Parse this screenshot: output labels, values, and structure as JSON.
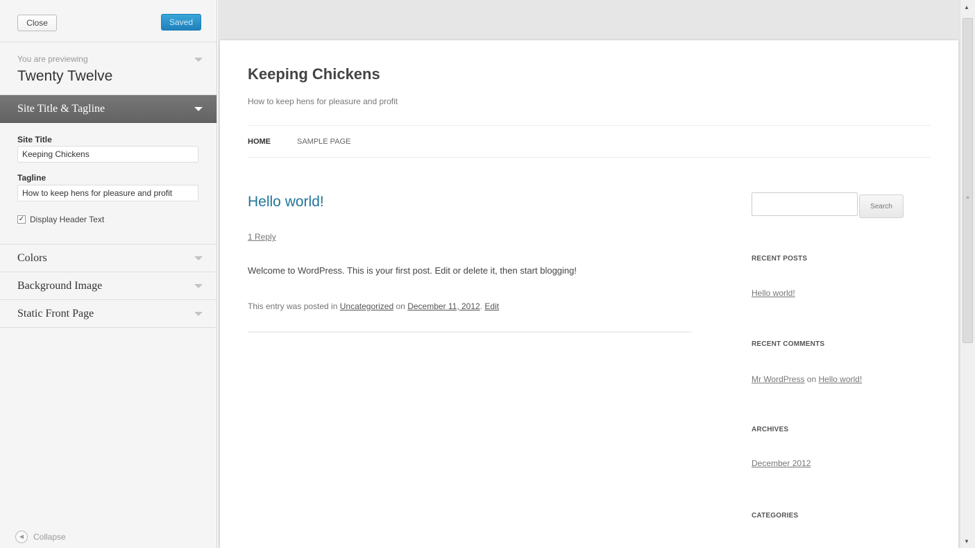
{
  "header": {
    "close_label": "Close",
    "saved_label": "Saved"
  },
  "preview_info": {
    "small_text": "You are previewing",
    "theme_name": "Twenty Twelve"
  },
  "sections": {
    "site_title": "Site Title & Tagline",
    "colors": "Colors",
    "background": "Background Image",
    "static_front": "Static Front Page"
  },
  "fields": {
    "site_title_label": "Site Title",
    "site_title_value": "Keeping Chickens",
    "tagline_label": "Tagline",
    "tagline_value": "How to keep hens for pleasure and profit",
    "display_header_label": "Display Header Text",
    "display_header_checked": true
  },
  "footer": {
    "collapse_label": "Collapse"
  },
  "site": {
    "title": "Keeping Chickens",
    "tagline": "How to keep hens for pleasure and profit",
    "nav": [
      "HOME",
      "SAMPLE PAGE"
    ]
  },
  "post": {
    "title": "Hello world!",
    "reply": "1 Reply",
    "body": "Welcome to WordPress. This is your first post. Edit or delete it, then start blogging!",
    "meta_prefix": "This entry was posted in",
    "category": "Uncategorized",
    "meta_on": "on",
    "date": "December 11, 2012",
    "meta_sep": ".",
    "edit": "Edit"
  },
  "widgets": {
    "search_button": "Search",
    "recent_posts_heading": "RECENT POSTS",
    "recent_post_link": "Hello world!",
    "recent_comments_heading": "RECENT COMMENTS",
    "comment_author": "Mr WordPress",
    "comment_on": "on",
    "comment_post": "Hello world!",
    "archives_heading": "ARCHIVES",
    "archive_link": "December 2012",
    "categories_heading": "CATEGORIES"
  },
  "colors": {
    "accent": "#21759b",
    "saved_button": "#2080bb",
    "active_section": "#6b6b6b"
  }
}
